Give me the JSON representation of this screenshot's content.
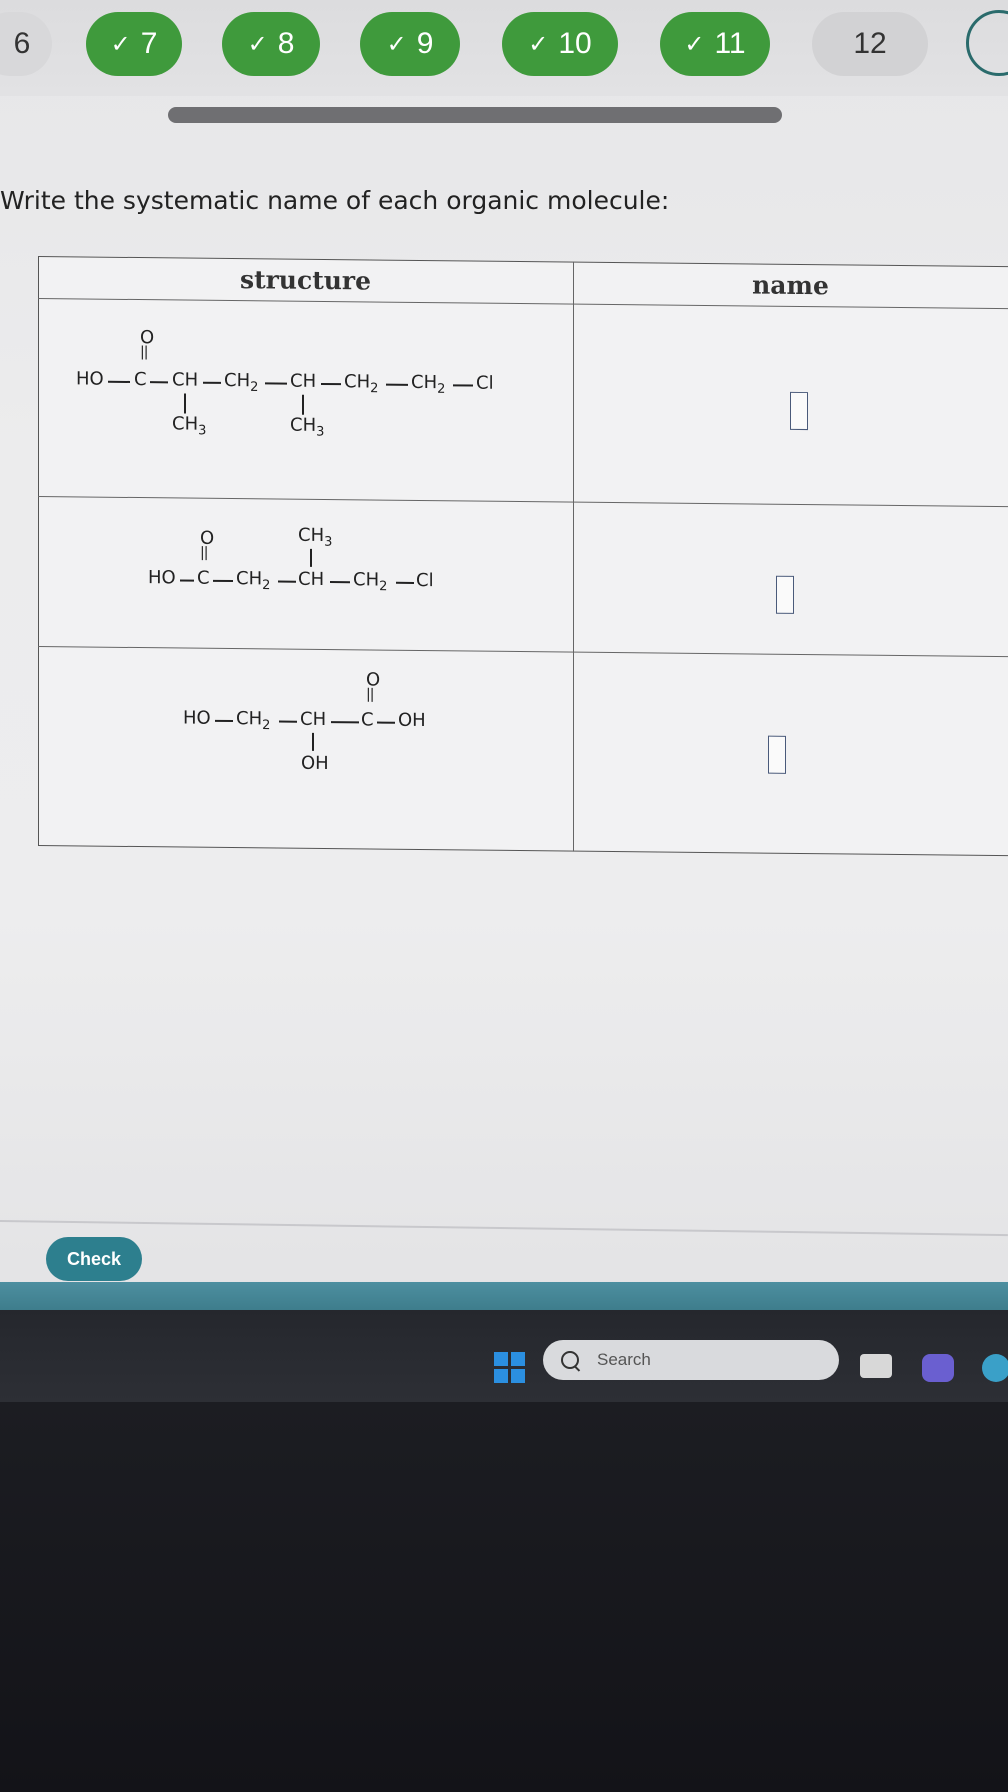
{
  "nav": {
    "items": [
      {
        "label": "6",
        "state": "partial"
      },
      {
        "label": "7",
        "state": "done"
      },
      {
        "label": "8",
        "state": "done"
      },
      {
        "label": "9",
        "state": "done"
      },
      {
        "label": "10",
        "state": "done"
      },
      {
        "label": "11",
        "state": "done"
      },
      {
        "label": "12",
        "state": "plain"
      }
    ],
    "check_symbol": "✓"
  },
  "instruction": "Write the systematic name of each organic molecule:",
  "table": {
    "headers": {
      "structure": "structure",
      "name": "name"
    },
    "molecules": [
      {
        "o": "O",
        "dbl": "||",
        "ho": "HO",
        "c": "C",
        "ch1": "CH",
        "ch2a": "CH",
        "ch2a_sub": "2",
        "ch3": "CH",
        "ch2b": "CH",
        "ch2b_sub": "2",
        "ch2c": "CH",
        "ch2c_sub": "2",
        "cl": "Cl",
        "me1": "CH",
        "me1_sub": "3",
        "me2": "CH",
        "me2_sub": "3"
      },
      {
        "o": "O",
        "dbl": "||",
        "ho": "HO",
        "c": "C",
        "ch2a": "CH",
        "ch2a_sub": "2",
        "ch": "CH",
        "ch2b": "CH",
        "ch2b_sub": "2",
        "cl": "Cl",
        "me": "CH",
        "me_sub": "3"
      },
      {
        "o": "O",
        "dbl": "||",
        "ho": "HO",
        "ch2": "CH",
        "ch2_sub": "2",
        "ch": "CH",
        "c": "C",
        "oh1": "OH",
        "oh2": "OH"
      }
    ]
  },
  "check_button": "Check",
  "taskbar": {
    "search_placeholder": "Search"
  },
  "colors": {
    "done": "#3f9a3c",
    "accent": "#2d7f8e",
    "windows_blue": "#2b8fe0"
  }
}
